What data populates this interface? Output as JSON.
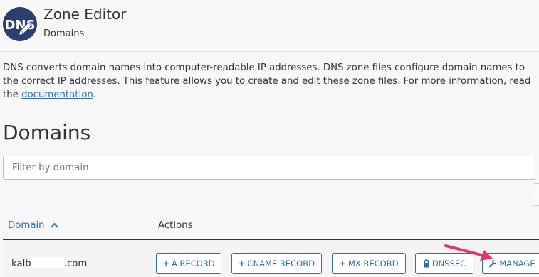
{
  "header": {
    "app_icon_text": "DNS",
    "title": "Zone Editor",
    "breadcrumb": "Domains"
  },
  "description": {
    "text": "DNS converts domain names into computer-readable IP addresses. DNS zone files configure domain names to the correct IP addresses. This feature allows you to create and edit these zone files. For more information, read the ",
    "link_text": "documentation",
    "trailing": "."
  },
  "section": {
    "title": "Domains"
  },
  "filter": {
    "placeholder": "Filter by domain",
    "value": ""
  },
  "table": {
    "columns": {
      "domain": "Domain",
      "actions": "Actions"
    },
    "sort": "ascending",
    "rows": [
      {
        "domain_prefix": "kalb",
        "domain_suffix": ".com",
        "buttons": {
          "a_record": "A RECORD",
          "cname_record": "CNAME RECORD",
          "mx_record": "MX RECORD",
          "dnssec": "DNSSEC",
          "manage": "MANAGE"
        }
      }
    ]
  },
  "colors": {
    "accent": "#2f6faa",
    "annotation_arrow": "#e8336b",
    "filter_border": "#8fd3e3"
  }
}
